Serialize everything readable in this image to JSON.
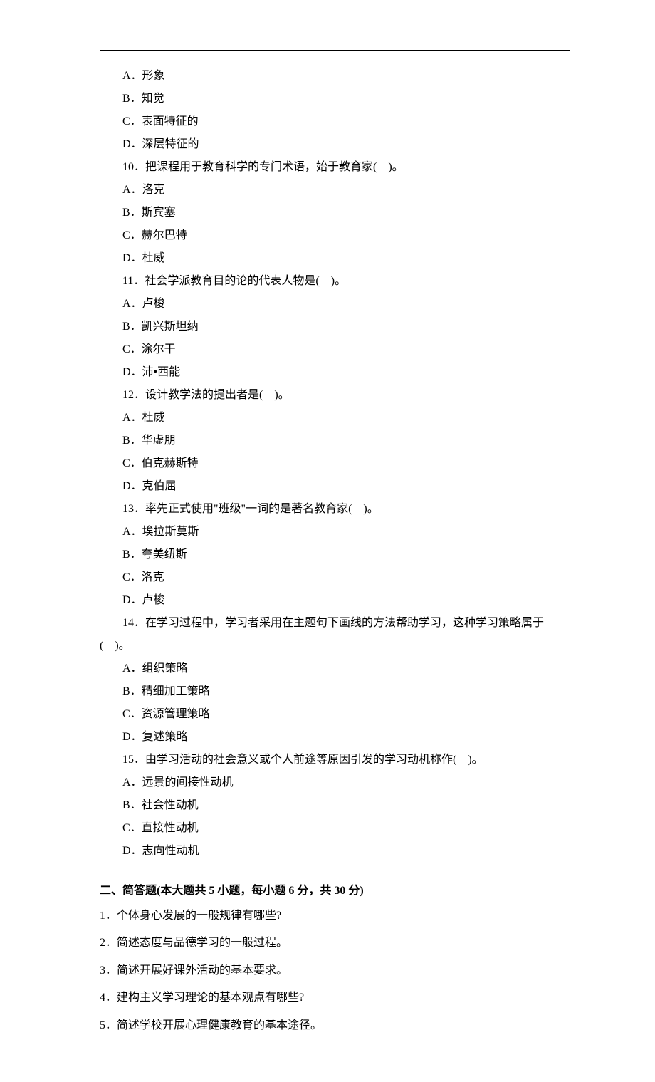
{
  "q9_options": [
    {
      "label": "A．形象"
    },
    {
      "label": "B．知觉"
    },
    {
      "label": "C．表面特征的"
    },
    {
      "label": "D．深层特征的"
    }
  ],
  "questions": [
    {
      "num": "10",
      "stem": "10．把课程用于教育科学的专门术语，始于教育家(　)。",
      "options": [
        "A．洛克",
        "B．斯宾塞",
        "C．赫尔巴特",
        "D．杜威"
      ]
    },
    {
      "num": "11",
      "stem": "11．社会学派教育目的论的代表人物是(　)。",
      "options": [
        "A．卢梭",
        "B．凯兴斯坦纳",
        "C．涂尔干",
        "D．沛•西能"
      ]
    },
    {
      "num": "12",
      "stem": "12．设计教学法的提出者是(　)。",
      "options": [
        "A．杜威",
        "B．华虚朋",
        "C．伯克赫斯特",
        "D．克伯屈"
      ]
    },
    {
      "num": "13",
      "stem": "13．率先正式使用\"班级\"一词的是著名教育家(　)。",
      "options": [
        "A．埃拉斯莫斯",
        "B．夸美纽斯",
        "C．洛克",
        "D．卢梭"
      ]
    },
    {
      "num": "14",
      "stem": "14．在学习过程中，学习者采用在主题句下画线的方法帮助学习，这种学习策略属于(　)。",
      "options": [
        "A．组织策略",
        "B．精细加工策略",
        "C．资源管理策略",
        "D．复述策略"
      ]
    },
    {
      "num": "15",
      "stem": "15．由学习活动的社会意义或个人前途等原因引发的学习动机称作(　)。",
      "options": [
        "A．远景的间接性动机",
        "B．社会性动机",
        "C．直接性动机",
        "D．志向性动机"
      ]
    }
  ],
  "section2": {
    "header": "二、简答题(本大题共 5 小题，每小题 6 分，共 30 分)",
    "items": [
      "1．个体身心发展的一般规律有哪些?",
      "2．简述态度与品德学习的一般过程。",
      "3．简述开展好课外活动的基本要求。",
      "4．建构主义学习理论的基本观点有哪些?",
      "5．简述学校开展心理健康教育的基本途径。"
    ]
  }
}
